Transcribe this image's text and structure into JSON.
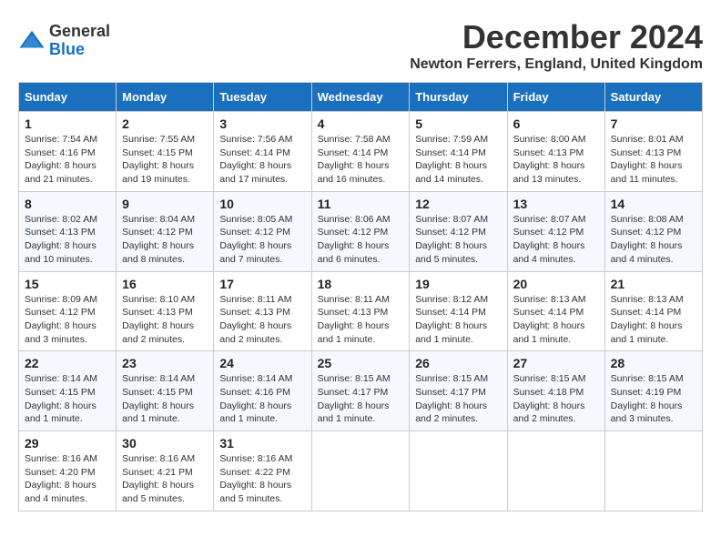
{
  "logo": {
    "general": "General",
    "blue": "Blue"
  },
  "title": "December 2024",
  "location": "Newton Ferrers, England, United Kingdom",
  "days_of_week": [
    "Sunday",
    "Monday",
    "Tuesday",
    "Wednesday",
    "Thursday",
    "Friday",
    "Saturday"
  ],
  "weeks": [
    [
      {
        "day": "1",
        "info": "Sunrise: 7:54 AM\nSunset: 4:16 PM\nDaylight: 8 hours\nand 21 minutes."
      },
      {
        "day": "2",
        "info": "Sunrise: 7:55 AM\nSunset: 4:15 PM\nDaylight: 8 hours\nand 19 minutes."
      },
      {
        "day": "3",
        "info": "Sunrise: 7:56 AM\nSunset: 4:14 PM\nDaylight: 8 hours\nand 17 minutes."
      },
      {
        "day": "4",
        "info": "Sunrise: 7:58 AM\nSunset: 4:14 PM\nDaylight: 8 hours\nand 16 minutes."
      },
      {
        "day": "5",
        "info": "Sunrise: 7:59 AM\nSunset: 4:14 PM\nDaylight: 8 hours\nand 14 minutes."
      },
      {
        "day": "6",
        "info": "Sunrise: 8:00 AM\nSunset: 4:13 PM\nDaylight: 8 hours\nand 13 minutes."
      },
      {
        "day": "7",
        "info": "Sunrise: 8:01 AM\nSunset: 4:13 PM\nDaylight: 8 hours\nand 11 minutes."
      }
    ],
    [
      {
        "day": "8",
        "info": "Sunrise: 8:02 AM\nSunset: 4:13 PM\nDaylight: 8 hours\nand 10 minutes."
      },
      {
        "day": "9",
        "info": "Sunrise: 8:04 AM\nSunset: 4:12 PM\nDaylight: 8 hours\nand 8 minutes."
      },
      {
        "day": "10",
        "info": "Sunrise: 8:05 AM\nSunset: 4:12 PM\nDaylight: 8 hours\nand 7 minutes."
      },
      {
        "day": "11",
        "info": "Sunrise: 8:06 AM\nSunset: 4:12 PM\nDaylight: 8 hours\nand 6 minutes."
      },
      {
        "day": "12",
        "info": "Sunrise: 8:07 AM\nSunset: 4:12 PM\nDaylight: 8 hours\nand 5 minutes."
      },
      {
        "day": "13",
        "info": "Sunrise: 8:07 AM\nSunset: 4:12 PM\nDaylight: 8 hours\nand 4 minutes."
      },
      {
        "day": "14",
        "info": "Sunrise: 8:08 AM\nSunset: 4:12 PM\nDaylight: 8 hours\nand 4 minutes."
      }
    ],
    [
      {
        "day": "15",
        "info": "Sunrise: 8:09 AM\nSunset: 4:12 PM\nDaylight: 8 hours\nand 3 minutes."
      },
      {
        "day": "16",
        "info": "Sunrise: 8:10 AM\nSunset: 4:13 PM\nDaylight: 8 hours\nand 2 minutes."
      },
      {
        "day": "17",
        "info": "Sunrise: 8:11 AM\nSunset: 4:13 PM\nDaylight: 8 hours\nand 2 minutes."
      },
      {
        "day": "18",
        "info": "Sunrise: 8:11 AM\nSunset: 4:13 PM\nDaylight: 8 hours\nand 1 minute."
      },
      {
        "day": "19",
        "info": "Sunrise: 8:12 AM\nSunset: 4:14 PM\nDaylight: 8 hours\nand 1 minute."
      },
      {
        "day": "20",
        "info": "Sunrise: 8:13 AM\nSunset: 4:14 PM\nDaylight: 8 hours\nand 1 minute."
      },
      {
        "day": "21",
        "info": "Sunrise: 8:13 AM\nSunset: 4:14 PM\nDaylight: 8 hours\nand 1 minute."
      }
    ],
    [
      {
        "day": "22",
        "info": "Sunrise: 8:14 AM\nSunset: 4:15 PM\nDaylight: 8 hours\nand 1 minute."
      },
      {
        "day": "23",
        "info": "Sunrise: 8:14 AM\nSunset: 4:15 PM\nDaylight: 8 hours\nand 1 minute."
      },
      {
        "day": "24",
        "info": "Sunrise: 8:14 AM\nSunset: 4:16 PM\nDaylight: 8 hours\nand 1 minute."
      },
      {
        "day": "25",
        "info": "Sunrise: 8:15 AM\nSunset: 4:17 PM\nDaylight: 8 hours\nand 1 minute."
      },
      {
        "day": "26",
        "info": "Sunrise: 8:15 AM\nSunset: 4:17 PM\nDaylight: 8 hours\nand 2 minutes."
      },
      {
        "day": "27",
        "info": "Sunrise: 8:15 AM\nSunset: 4:18 PM\nDaylight: 8 hours\nand 2 minutes."
      },
      {
        "day": "28",
        "info": "Sunrise: 8:15 AM\nSunset: 4:19 PM\nDaylight: 8 hours\nand 3 minutes."
      }
    ],
    [
      {
        "day": "29",
        "info": "Sunrise: 8:16 AM\nSunset: 4:20 PM\nDaylight: 8 hours\nand 4 minutes."
      },
      {
        "day": "30",
        "info": "Sunrise: 8:16 AM\nSunset: 4:21 PM\nDaylight: 8 hours\nand 5 minutes."
      },
      {
        "day": "31",
        "info": "Sunrise: 8:16 AM\nSunset: 4:22 PM\nDaylight: 8 hours\nand 5 minutes."
      },
      {
        "day": "",
        "info": ""
      },
      {
        "day": "",
        "info": ""
      },
      {
        "day": "",
        "info": ""
      },
      {
        "day": "",
        "info": ""
      }
    ]
  ]
}
